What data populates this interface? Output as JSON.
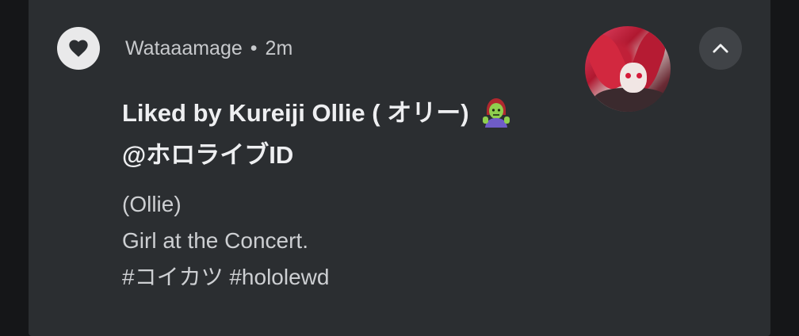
{
  "notification": {
    "app_icon": "heart-icon",
    "sender": "Wataaamage",
    "separator": "•",
    "time": "2m",
    "title_line1": "Liked by Kureiji Ollie ( オリー)",
    "title_emoji": "🧟‍♀️",
    "title_line2": "@ホロライブID",
    "body_lines": [
      "(Ollie)",
      "Girl at the Concert.",
      "#コイカツ #hololewd"
    ],
    "expand_icon": "chevron-up-icon"
  },
  "colors": {
    "card_background": "#2b2e31",
    "page_background": "#151618",
    "title_text": "#eeeff1",
    "body_text": "#cdcfd2"
  }
}
